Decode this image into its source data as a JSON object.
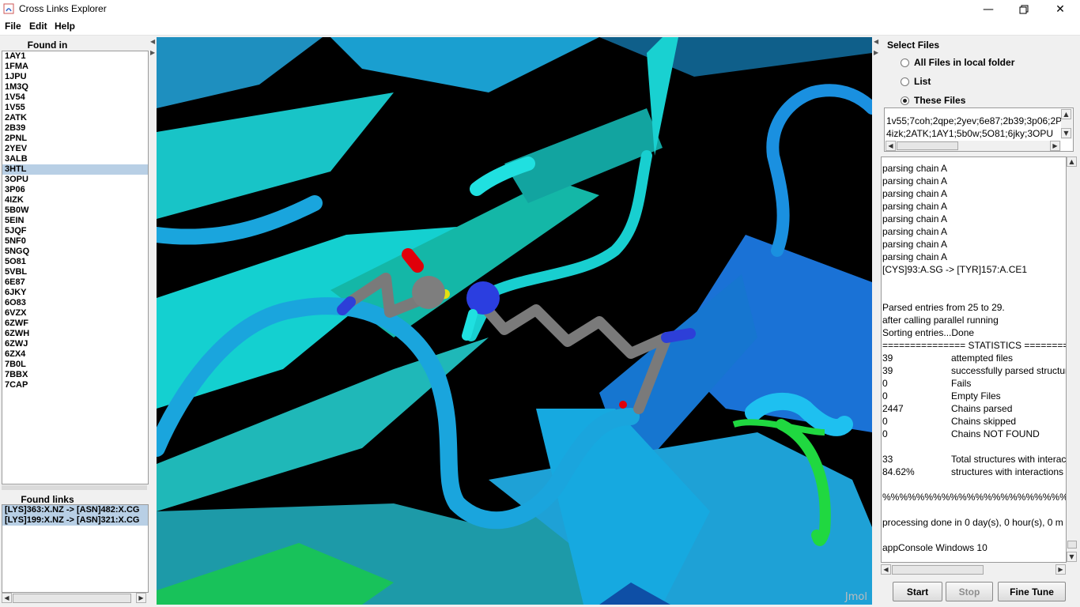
{
  "window": {
    "title": "Cross Links Explorer",
    "controls": [
      "minimize",
      "maximize",
      "close"
    ]
  },
  "menu": [
    "File",
    "Edit",
    "Help"
  ],
  "found_in": {
    "header": "Found in",
    "items": [
      "1AY1",
      "1FMA",
      "1JPU",
      "1M3Q",
      "1V54",
      "1V55",
      "2ATK",
      "2B39",
      "2PNL",
      "2YEV",
      "3ALB",
      "3HTL",
      "3OPU",
      "3P06",
      "4IZK",
      "5B0W",
      "5EIN",
      "5JQF",
      "5NF0",
      "5NGQ",
      "5O81",
      "5VBL",
      "6E87",
      "6JKY",
      "6O83",
      "6VZX",
      "6ZWF",
      "6ZWH",
      "6ZWJ",
      "6ZX4",
      "7B0L",
      "7BBX",
      "7CAP"
    ],
    "selected": "3HTL"
  },
  "found_links": {
    "header": "Found links",
    "items": [
      "[LYS]363:X.NZ  -> [ASN]482:X.CG",
      "[LYS]199:X.NZ  -> [ASN]321:X.CG"
    ]
  },
  "viewer": {
    "label": "Jmol"
  },
  "select_files": {
    "header": "Select Files",
    "options": [
      "All Files in local folder",
      "List",
      "These Files"
    ],
    "selected": "These Files",
    "files_text": [
      "1v55;7coh;2qpe;2yev;6e87;2b39;3p06;2P",
      "4izk;2ATK;1AY1;5b0w;5O81;6jky;3OPU"
    ]
  },
  "console": {
    "lines": [
      "parsing chain A",
      "parsing chain A",
      "parsing chain A",
      "parsing chain A",
      "parsing chain A",
      "parsing chain A",
      "parsing chain A",
      "parsing chain A",
      "[CYS]93:A.SG    -> [TYR]157:A.CE1",
      "",
      "",
      "Parsed entries from 25 to 29.",
      "after calling parallel running",
      "Sorting entries...Done",
      "=============== STATISTICS =========="
    ],
    "stats": [
      {
        "value": "39",
        "label": "attempted files"
      },
      {
        "value": "39",
        "label": "successfully parsed structures"
      },
      {
        "value": "0",
        "label": "Fails"
      },
      {
        "value": "0",
        "label": "Empty Files"
      },
      {
        "value": "2447",
        "label": "Chains parsed"
      },
      {
        "value": "0",
        "label": "Chains skipped"
      },
      {
        "value": "0",
        "label": "Chains NOT FOUND"
      },
      {
        "value": "",
        "label": ""
      },
      {
        "value": "33",
        "label": "Total structures with interactions"
      },
      {
        "value": "84.62%",
        "label": "structures with interactions"
      }
    ],
    "tail": [
      "",
      "%%%%%%%%%%%%%%%%%%%%%%%%%%%",
      "",
      "processing done in 0 day(s), 0 hour(s), 0 m",
      "",
      "appConsole Windows 10"
    ]
  },
  "buttons": {
    "start": "Start",
    "stop": "Stop",
    "fine_tune": "Fine Tune"
  },
  "colors": {
    "selection": "#b8cfe5",
    "viewer_bg": "#000000",
    "ribbon_blue": "#1aa7e0",
    "ribbon_cyan": "#14d8d8",
    "ribbon_green": "#1fd24a"
  }
}
